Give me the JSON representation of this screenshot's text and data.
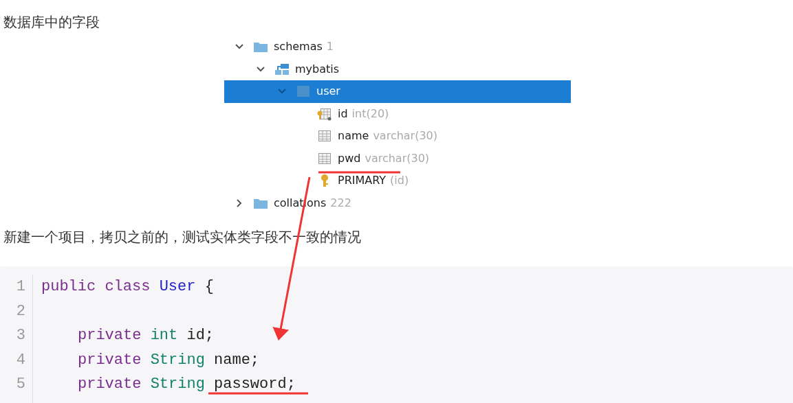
{
  "heading": "数据库中的字段",
  "db_tree": {
    "rows": [
      {
        "kind": "folder",
        "label": "schemas",
        "count": "1",
        "expanded": true,
        "selected": false,
        "children": [
          {
            "kind": "schema",
            "label": "mybatis",
            "expanded": true,
            "selected": false,
            "children": [
              {
                "kind": "table",
                "label": "user",
                "expanded": true,
                "selected": true,
                "children": [
                  {
                    "kind": "key-column",
                    "label": "id",
                    "type": "int(20)"
                  },
                  {
                    "kind": "column",
                    "label": "name",
                    "type": "varchar(30)"
                  },
                  {
                    "kind": "column",
                    "label": "pwd",
                    "type": "varchar(30)"
                  },
                  {
                    "kind": "primary-key",
                    "label": "PRIMARY",
                    "type": "(id)"
                  }
                ]
              }
            ]
          }
        ]
      },
      {
        "kind": "folder",
        "label": "collations",
        "count": "222",
        "expanded": false,
        "selected": false
      }
    ]
  },
  "note": "新建一个项目，拷贝之前的，测试实体类字段不一致的情况",
  "code": {
    "lines": [
      {
        "number": "1",
        "tokens": [
          {
            "kind": "keyword",
            "text": "public class "
          },
          {
            "kind": "class",
            "text": "User"
          },
          {
            "kind": "plain",
            "text": " {"
          }
        ]
      },
      {
        "number": "2"
      },
      {
        "number": "3",
        "indented": true,
        "tokens": [
          {
            "kind": "keyword",
            "text": "private "
          },
          {
            "kind": "type",
            "text": "int"
          },
          {
            "kind": "plain",
            "text": " id;"
          }
        ]
      },
      {
        "number": "4",
        "indented": true,
        "tokens": [
          {
            "kind": "keyword",
            "text": "private "
          },
          {
            "kind": "type",
            "text": "String"
          },
          {
            "kind": "plain",
            "text": " name;"
          }
        ]
      },
      {
        "number": "5",
        "indented": true,
        "tokens": [
          {
            "kind": "keyword",
            "text": "private "
          },
          {
            "kind": "type",
            "text": "String"
          },
          {
            "kind": "plain",
            "text": " password;"
          }
        ]
      }
    ]
  }
}
